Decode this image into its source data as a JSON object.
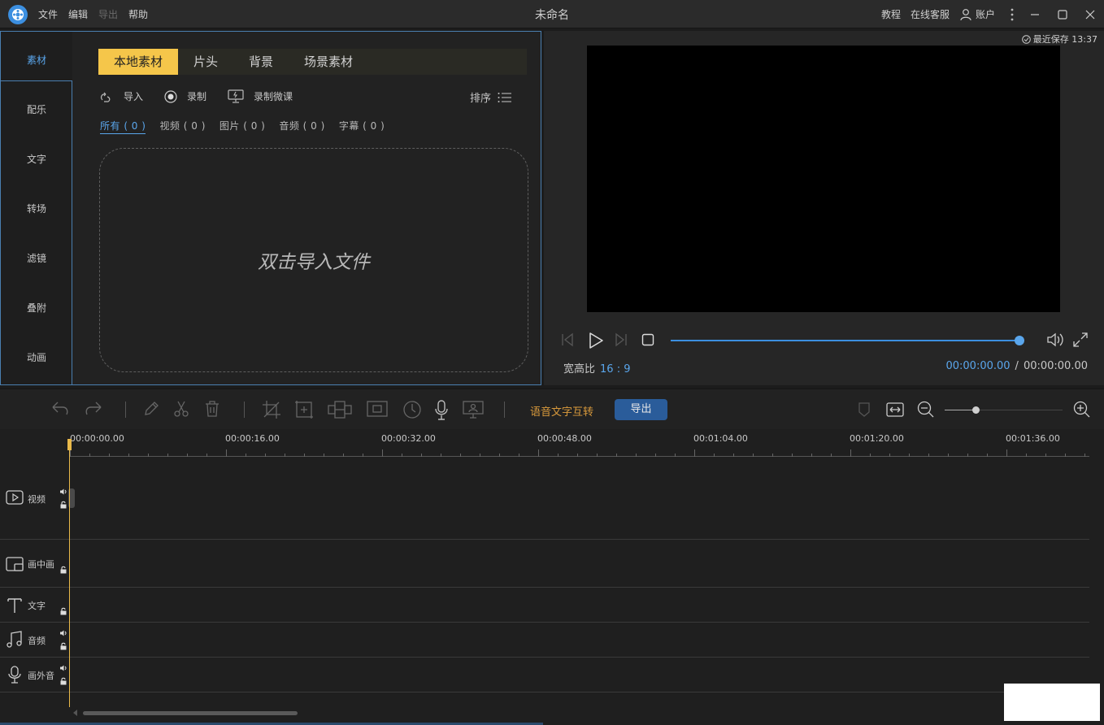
{
  "title_bar": {
    "menu": [
      "文件",
      "编辑",
      "导出",
      "帮助"
    ],
    "title": "未命名",
    "tutorial": "教程",
    "support": "在线客服",
    "account": "账户"
  },
  "sidebar": {
    "items": [
      "素材",
      "配乐",
      "文字",
      "转场",
      "滤镜",
      "叠附",
      "动画"
    ]
  },
  "library": {
    "tabs": [
      "本地素材",
      "片头",
      "背景",
      "场景素材"
    ],
    "import_label": "导入",
    "record_label": "录制",
    "record_lesson_label": "录制微课",
    "sort_label": "排序",
    "filters": [
      "所有 ( 0 )",
      "视频 ( 0 )",
      "图片 ( 0 )",
      "音频 ( 0 )",
      "字幕 ( 0 )"
    ],
    "dropzone_text": "双击导入文件"
  },
  "preview": {
    "saved_text": "最近保存 13:37",
    "aspect_label": "宽高比",
    "aspect_value": "16 : 9",
    "current_time": "00:00:00.00",
    "separator": "/",
    "total_time": "00:00:00.00",
    "progress": 1.0
  },
  "timeline": {
    "speech_text_label": "语音文字互转",
    "export_label": "导出",
    "zoom_level": 0.26,
    "ruler_labels": [
      "00:00:00.00",
      "00:00:16.00",
      "00:00:32.00",
      "00:00:48.00",
      "00:01:04.00",
      "00:01:20.00",
      "00:01:36.00"
    ],
    "tracks": [
      "视频",
      "画中画",
      "文字",
      "音频",
      "画外音"
    ]
  },
  "colors": {
    "accent": "#3c8fe0",
    "tab_active": "#f5c64a",
    "playhead": "#e9b94a",
    "speech_text": "#d99a3c"
  }
}
